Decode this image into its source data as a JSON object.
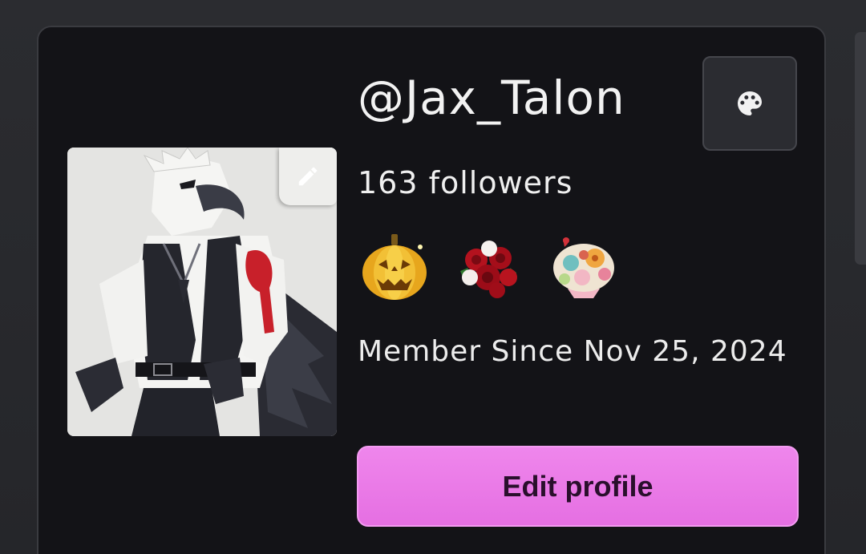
{
  "profile": {
    "username": "@Jax_Talon",
    "followers": "163 followers",
    "member_since": "Member Since Nov 25, 2024",
    "avatar_alt": "avatar",
    "badges": [
      {
        "icon": "jack-o-lantern-icon"
      },
      {
        "icon": "rose-bouquet-icon"
      },
      {
        "icon": "flower-bouquet-icon"
      }
    ]
  },
  "actions": {
    "edit_profile_label": "Edit profile",
    "theme_icon": "palette-icon",
    "avatar_edit_icon": "pencil-icon"
  },
  "colors": {
    "accent": "#e97ee6",
    "card_bg": "#131317",
    "page_bg": "#2b2c30"
  }
}
